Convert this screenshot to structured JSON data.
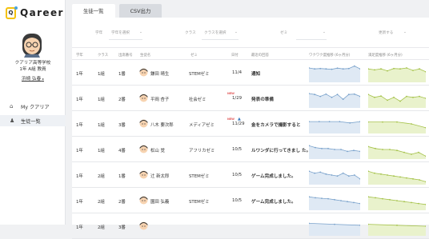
{
  "app": {
    "logo_text": "Qareer",
    "logo_mark": "Q"
  },
  "profile": {
    "school": "クアリア高等学校",
    "class_info": "1年 A組 教員",
    "name": "浜崎 弘春",
    "name_suffix": "▸"
  },
  "nav": [
    {
      "label": "My クアリア",
      "icon": "home-icon",
      "active": false
    },
    {
      "label": "生徒一覧",
      "icon": "person-icon",
      "active": true
    }
  ],
  "tabs": [
    {
      "label": "生徒一覧",
      "active": true
    },
    {
      "label": "CSV出力",
      "active": false
    }
  ],
  "filters": {
    "grade_label": "学年",
    "grade_placeholder": "学年を選択",
    "class_label": "クラス",
    "class_placeholder": "クラスを選択",
    "seminar_label": "ゼミ",
    "update_label": "更新する"
  },
  "columns": [
    "学年",
    "クラス",
    "出席番号",
    "生徒名",
    "ゼミ",
    "日付",
    "最近の回答",
    "ワクワク度推移 (6ヶ月分)",
    "満足度推移 (6ヶ月分)"
  ],
  "rows": [
    {
      "grade": "1年",
      "class": "1組",
      "number": "1番",
      "name": "鎌田 晴生",
      "seminar": "STEMゼミ",
      "date": "11/4",
      "answer": "通知",
      "new": "",
      "cap": false,
      "waku": [
        0.75,
        0.7,
        0.72,
        0.7,
        0.68,
        0.74,
        0.7,
        0.72,
        0.85,
        0.7
      ],
      "man": [
        0.7,
        0.65,
        0.7,
        0.6,
        0.72,
        0.7,
        0.75,
        0.62,
        0.7,
        0.55
      ]
    },
    {
      "grade": "1年",
      "class": "1組",
      "number": "2番",
      "name": "平岡 杏子",
      "seminar": "社会ゼミ",
      "date": "1/29",
      "answer": "発表の準備",
      "new": "NEW",
      "cap": false,
      "waku": [
        0.75,
        0.7,
        0.6,
        0.72,
        0.55,
        0.7,
        0.45,
        0.7,
        0.72,
        0.6
      ],
      "man": [
        0.7,
        0.55,
        0.62,
        0.4,
        0.55,
        0.35,
        0.6,
        0.55,
        0.6,
        0.5
      ]
    },
    {
      "grade": "1年",
      "class": "1組",
      "number": "3番",
      "name": "八木 要次郎",
      "seminar": "メディアゼミ",
      "date": "11/29",
      "answer": "金をカメラで撮影すると",
      "new": "NEW",
      "cap": true,
      "waku": [
        0.62,
        0.62,
        0.62,
        0.62,
        0.55,
        0.62
      ],
      "man": [
        0.6,
        0.6,
        0.6,
        0.5,
        0.3
      ]
    },
    {
      "grade": "1年",
      "class": "1組",
      "number": "4番",
      "name": "松山 覚",
      "seminar": "アフリカゼミ",
      "date": "10/5",
      "answer": "ルワンダに行ってきまし た。",
      "new": "",
      "cap": false,
      "waku": [
        0.7,
        0.6,
        0.55,
        0.55,
        0.5,
        0.5,
        0.4,
        0.45,
        0.4
      ],
      "man": [
        0.65,
        0.55,
        0.5,
        0.5,
        0.45,
        0.35,
        0.25,
        0.35,
        0.15
      ]
    },
    {
      "grade": "1年",
      "class": "2組",
      "number": "1番",
      "name": "辻 新太郎",
      "seminar": "STEMゼミ",
      "date": "10/5",
      "answer": "ゲーム完成しました。",
      "new": "",
      "cap": false,
      "waku": [
        0.7,
        0.6,
        0.65,
        0.55,
        0.5,
        0.45,
        0.6,
        0.45,
        0.5,
        0.3
      ],
      "man": [
        0.7,
        0.6,
        0.55,
        0.5,
        0.45,
        0.4,
        0.35,
        0.3,
        0.25,
        0.15
      ]
    },
    {
      "grade": "1年",
      "class": "2組",
      "number": "2番",
      "name": "園田 弘義",
      "seminar": "STEMゼミ",
      "date": "10/5",
      "answer": "ゲーム完成しました。",
      "new": "",
      "cap": false,
      "waku": [
        0.7,
        0.65,
        0.62,
        0.6,
        0.55,
        0.5,
        0.45,
        0.4,
        0.35
      ],
      "man": [
        0.7,
        0.65,
        0.6,
        0.55,
        0.5,
        0.45,
        0.4,
        0.35,
        0.3
      ]
    },
    {
      "grade": "1年",
      "class": "2組",
      "number": "3番",
      "name": "",
      "seminar": "",
      "date": "",
      "answer": "",
      "new": "",
      "cap": false,
      "waku": [
        0.65,
        0.6,
        0.55
      ],
      "man": [
        0.6,
        0.55,
        0.5
      ]
    }
  ],
  "colors": {
    "waku_line": "#7ba3cc",
    "waku_fill": "#dfe9f4",
    "man_line": "#a5c24a",
    "man_fill": "#e9f2cc",
    "new": "#e05555"
  }
}
